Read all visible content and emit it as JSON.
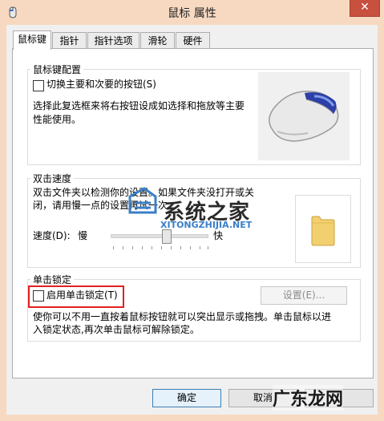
{
  "window": {
    "title": "鼠标 属性",
    "close_glyph": "✕"
  },
  "tabs": [
    {
      "label": "鼠标键",
      "active": true
    },
    {
      "label": "指针",
      "active": false
    },
    {
      "label": "指针选项",
      "active": false
    },
    {
      "label": "滑轮",
      "active": false
    },
    {
      "label": "硬件",
      "active": false
    }
  ],
  "button_config": {
    "title": "鼠标键配置",
    "switch_label": "切换主要和次要的按钮(S)",
    "switch_checked": false,
    "description_lines": [
      "选择此复选框来将右按钮设成如选择和拖放等主要",
      "性能使用。"
    ]
  },
  "double_click": {
    "title": "双击速度",
    "description_lines": [
      "双击文件夹以检测你的设置。如果文件夹没打开或关",
      "闭，请用慢一点的设置再试一次。"
    ],
    "speed_label": "速度(D):",
    "slow_label": "慢",
    "fast_label": "快",
    "speed_value": 0.6
  },
  "click_lock": {
    "title": "单击锁定",
    "enable_label": "启用单击锁定(T)",
    "enable_checked": false,
    "settings_label": "设置(E)...",
    "description_lines": [
      "使你可以不用一直按着鼠标按钮就可以突出显示或拖拽。单击鼠标以进",
      "入锁定状态,再次单击鼠标可解除锁定。"
    ]
  },
  "footer": {
    "ok_label": "确定",
    "cancel_label": "取消"
  },
  "watermarks": {
    "site_cn": "系统之家",
    "site_url": "XITONGZHIJIA.NET",
    "corner": "广东龙网"
  },
  "colors": {
    "titlebar": "#f7d9c1",
    "close": "#c7503f",
    "highlight": "#e02020"
  }
}
